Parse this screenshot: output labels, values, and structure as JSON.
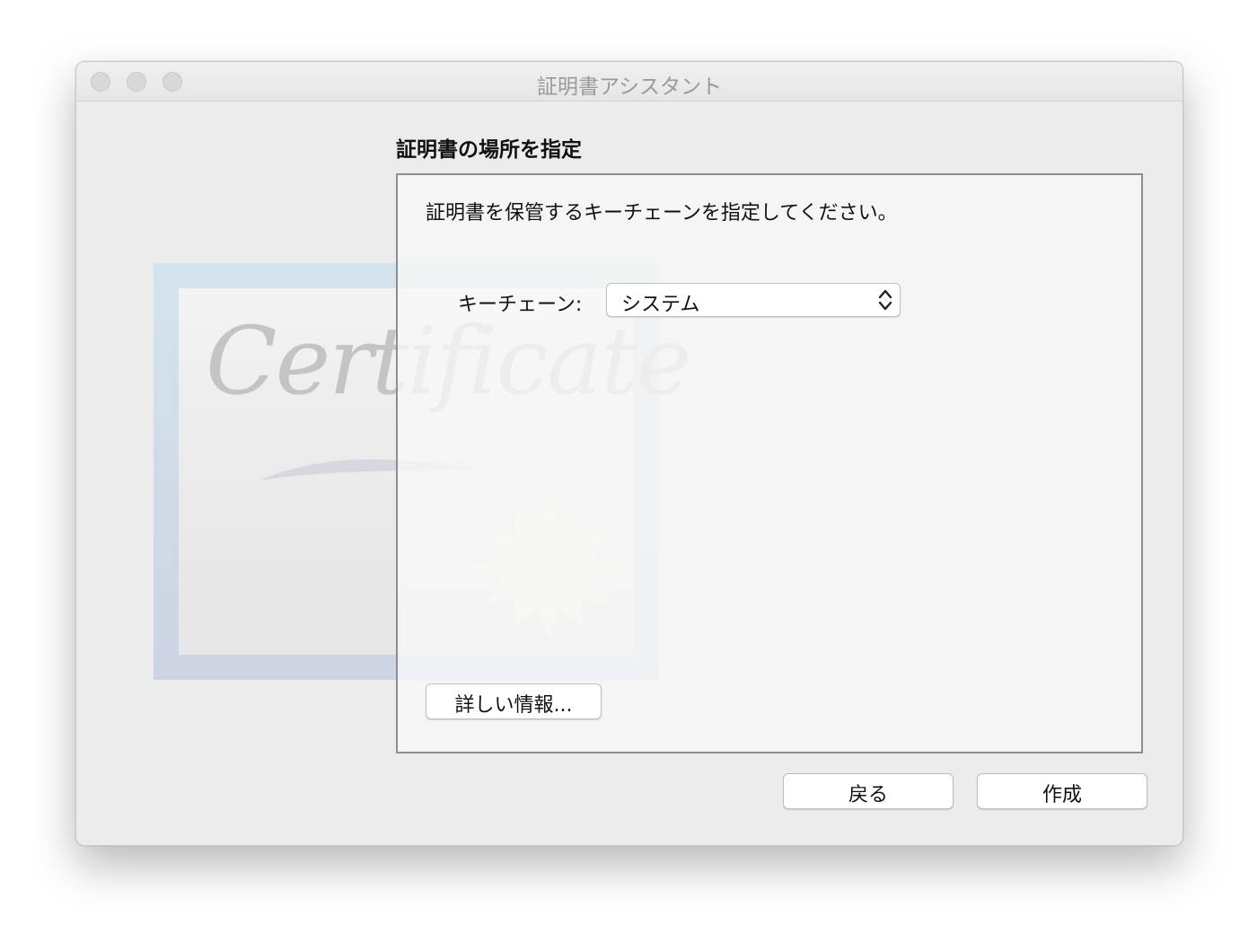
{
  "window": {
    "title": "証明書アシスタント"
  },
  "page": {
    "heading": "証明書の場所を指定",
    "instruction": "証明書を保管するキーチェーンを指定してください。",
    "keychain_label": "キーチェーン:",
    "keychain_value": "システム",
    "details_button": "詳しい情報...",
    "watermark_text": "Certificate"
  },
  "footer": {
    "back_button": "戻る",
    "create_button": "作成"
  },
  "colors": {
    "window_bg": "#ececec",
    "panel_border": "#8e8e8e",
    "title_text": "#9a9a9a"
  },
  "icons": {
    "close": "close-icon",
    "minimize": "minimize-icon",
    "zoom": "zoom-icon",
    "popup_arrows": "up-down-chevron-icon"
  }
}
